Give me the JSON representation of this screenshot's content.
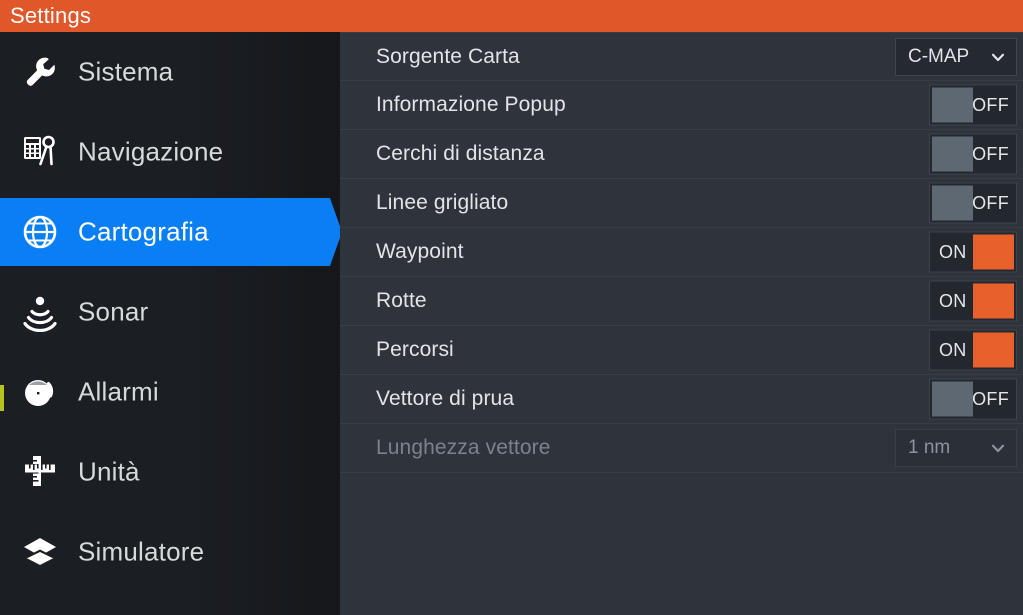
{
  "titlebar": {
    "title": "Settings"
  },
  "sidebar": {
    "items": [
      {
        "label": "Sistema",
        "icon": "wrench-icon",
        "selected": false
      },
      {
        "label": "Navigazione",
        "icon": "calculator-divider-icon",
        "selected": false
      },
      {
        "label": "Cartografia",
        "icon": "globe-icon",
        "selected": true
      },
      {
        "label": "Sonar",
        "icon": "sonar-icon",
        "selected": false
      },
      {
        "label": "Allarmi",
        "icon": "alarm-clock-icon",
        "selected": false
      },
      {
        "label": "Unità",
        "icon": "ruler-icon",
        "selected": false
      },
      {
        "label": "Simulatore",
        "icon": "layers-icon",
        "selected": false
      }
    ]
  },
  "panel": {
    "rows": [
      {
        "label": "Sorgente Carta",
        "control": "dropdown",
        "value": "C-MAP",
        "disabled": false
      },
      {
        "label": "Informazione Popup",
        "control": "toggle",
        "value": "OFF",
        "disabled": false
      },
      {
        "label": "Cerchi di distanza",
        "control": "toggle",
        "value": "OFF",
        "disabled": false
      },
      {
        "label": "Linee grigliato",
        "control": "toggle",
        "value": "OFF",
        "disabled": false
      },
      {
        "label": "Waypoint",
        "control": "toggle",
        "value": "ON",
        "disabled": false
      },
      {
        "label": "Rotte",
        "control": "toggle",
        "value": "ON",
        "disabled": false
      },
      {
        "label": "Percorsi",
        "control": "toggle",
        "value": "ON",
        "disabled": false
      },
      {
        "label": "Vettore di prua",
        "control": "toggle",
        "value": "OFF",
        "disabled": false
      },
      {
        "label": "Lunghezza vettore",
        "control": "dropdown",
        "value": "1 nm",
        "disabled": true
      }
    ]
  },
  "colors": {
    "accent_orange": "#e0572a",
    "selection_blue": "#0a7ff5",
    "toggle_on": "#e8602c",
    "toggle_off": "#5d6873",
    "panel_bg": "#2f333b",
    "sidebar_bg": "#1b1e23",
    "marker_yellow": "#b7c41f"
  }
}
